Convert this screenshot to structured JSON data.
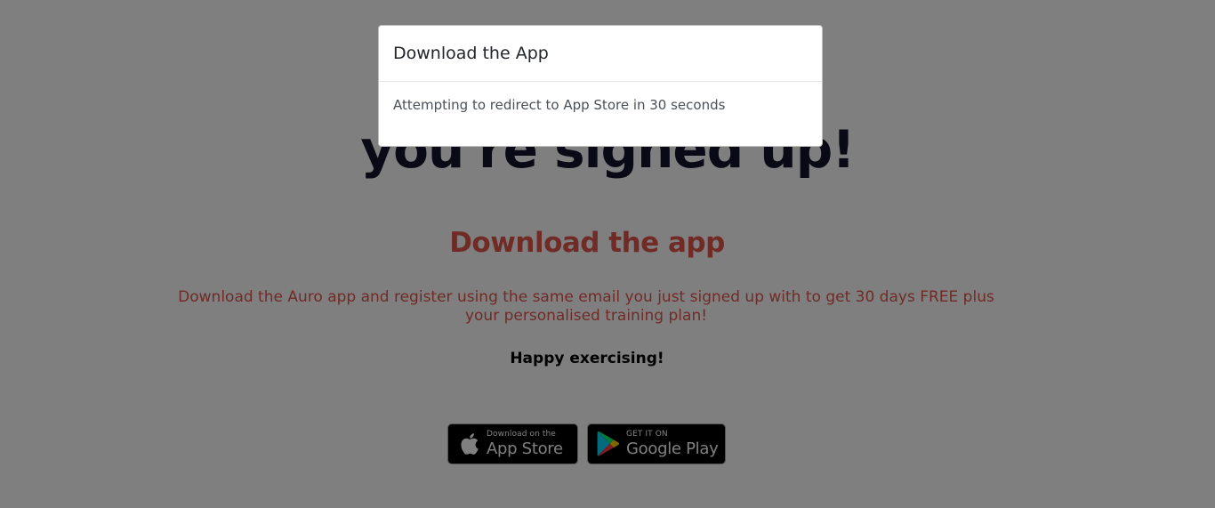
{
  "page": {
    "headline": "you're signed up!",
    "subhead": "Download the app",
    "description": "Download the Auro app and register using the same email you just signed up with to get 30 days FREE plus your personalised training plan!",
    "happy": "Happy exercising!"
  },
  "badges": {
    "apple": {
      "small": "Download on the",
      "big": "App Store",
      "icon": "apple-icon"
    },
    "google": {
      "small": "GET IT ON",
      "big": "Google Play",
      "icon": "google-play-icon"
    }
  },
  "modal": {
    "title": "Download the App",
    "body": "Attempting to redirect to App Store in 30 seconds"
  },
  "colors": {
    "headline": "#14142e",
    "accent": "#e0574c",
    "overlay": "rgba(0,0,0,0.5)"
  }
}
